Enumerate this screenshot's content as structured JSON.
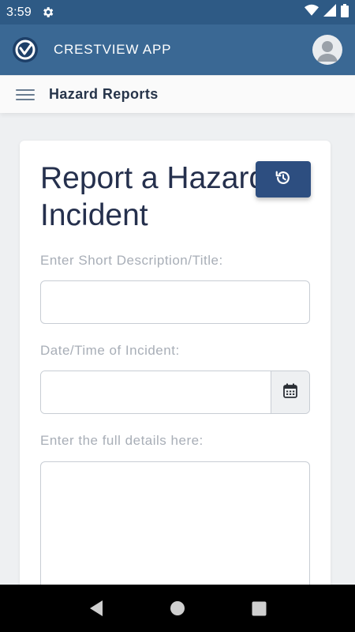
{
  "status_bar": {
    "time": "3:59",
    "icons": [
      "gear-icon",
      "wifi-icon",
      "signal-icon",
      "battery-icon"
    ]
  },
  "app_bar": {
    "title": "CRESTVIEW APP",
    "logo_icon": "crestview-logo",
    "avatar_icon": "user-avatar-icon"
  },
  "sub_bar": {
    "title": "Hazard Reports",
    "menu_icon": "hamburger-menu-icon"
  },
  "form": {
    "title": "Report a Hazard or Incident",
    "history_icon": "history-icon",
    "short_description_label": "Enter Short Description/Title:",
    "short_description_value": "",
    "datetime_label": "Date/Time of Incident:",
    "datetime_value": "",
    "calendar_icon": "calendar-icon",
    "details_label": "Enter the full details here:",
    "details_value": ""
  },
  "nav_bar": {
    "icons": [
      "back-icon",
      "home-icon",
      "recents-icon"
    ]
  },
  "colors": {
    "status_bar": "#2e5a85",
    "app_bar": "#3a6894",
    "primary_button": "#2d4e80",
    "title_text": "#25304d",
    "label_text": "#a8aeb7"
  }
}
